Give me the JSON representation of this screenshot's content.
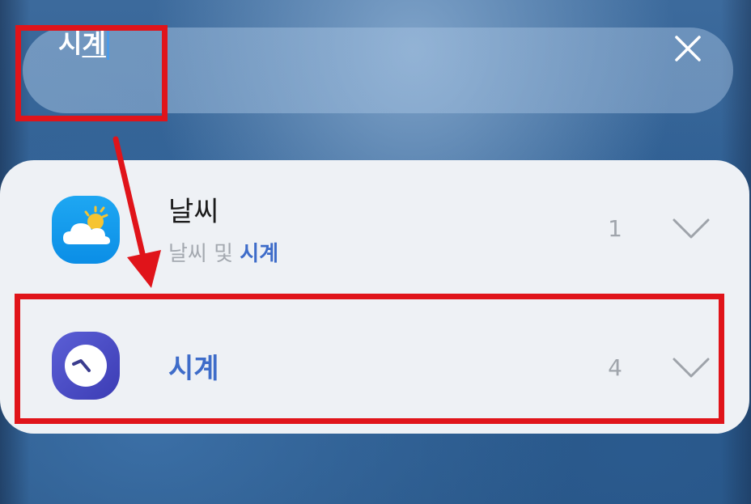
{
  "search": {
    "query_prefix": "시",
    "query_last": "계",
    "clear_icon": "close-icon"
  },
  "results": [
    {
      "app": "날씨",
      "subtitle_prefix": "날씨 및 ",
      "subtitle_highlight": "시계",
      "count": "1",
      "icon": "weather-icon"
    },
    {
      "app": "시계",
      "count": "4",
      "icon": "clock-icon"
    }
  ],
  "colors": {
    "highlight": "#3e6cc9",
    "annotation": "#e0141a",
    "panel": "#eef1f5"
  }
}
